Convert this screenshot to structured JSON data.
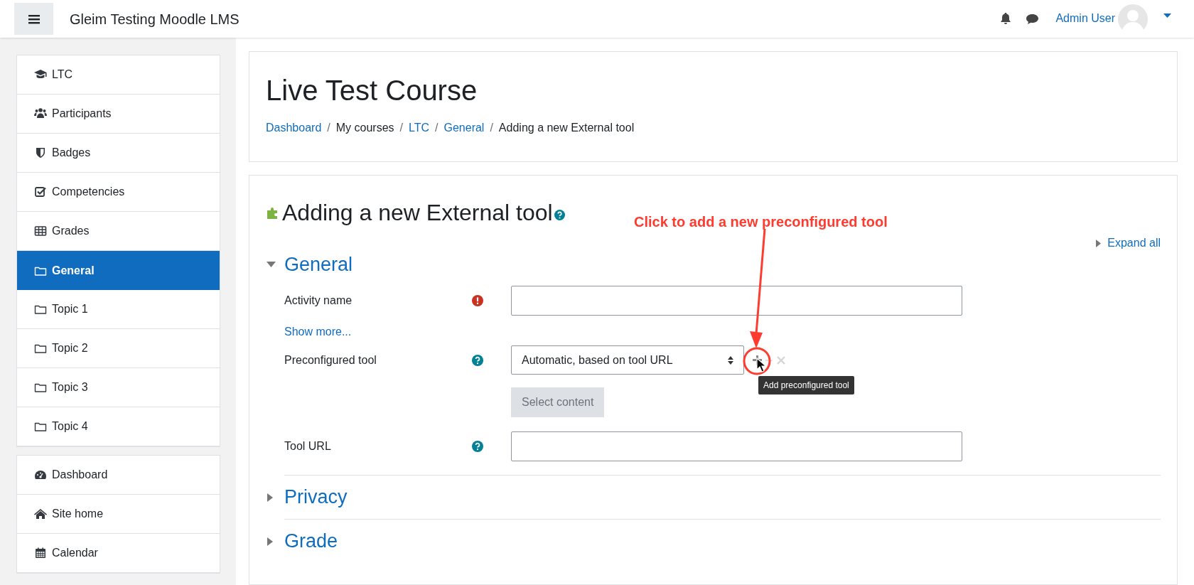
{
  "navbar": {
    "site_name": "Gleim Testing Moodle LMS",
    "user_name": "Admin User"
  },
  "sidebar": {
    "groups": [
      [
        {
          "label": "LTC",
          "selected": false
        },
        {
          "label": "Participants",
          "selected": false
        },
        {
          "label": "Badges",
          "selected": false
        },
        {
          "label": "Competencies",
          "selected": false
        },
        {
          "label": "Grades",
          "selected": false
        },
        {
          "label": "General",
          "selected": true
        },
        {
          "label": "Topic 1",
          "selected": false
        },
        {
          "label": "Topic 2",
          "selected": false
        },
        {
          "label": "Topic 3",
          "selected": false
        },
        {
          "label": "Topic 4",
          "selected": false
        }
      ],
      [
        {
          "label": "Dashboard",
          "selected": false
        },
        {
          "label": "Site home",
          "selected": false
        },
        {
          "label": "Calendar",
          "selected": false
        }
      ]
    ]
  },
  "course_header": {
    "title": "Live Test Course",
    "separator": "/",
    "breadcrumb": [
      {
        "label": "Dashboard",
        "link": true
      },
      {
        "label": "My courses",
        "link": false
      },
      {
        "label": "LTC",
        "link": true
      },
      {
        "label": "General",
        "link": true
      },
      {
        "label": "Adding a new External tool",
        "link": false
      }
    ]
  },
  "form": {
    "title": "Adding a new External tool",
    "expand_all": "Expand all",
    "sections": [
      {
        "title": "General",
        "expanded": true,
        "fields": [
          {
            "kind": "text",
            "label": "Activity name"
          },
          {
            "kind": "link",
            "label": "Show more..."
          },
          {
            "kind": "select",
            "label": "Preconfigured tool",
            "value": "Automatic, based on tool URL"
          },
          {
            "kind": "button",
            "label": "Select content"
          },
          {
            "kind": "text",
            "label": "Tool URL"
          }
        ]
      },
      {
        "title": "Privacy",
        "expanded": false
      },
      {
        "title": "Grade",
        "expanded": false
      }
    ]
  },
  "tooltip": "Add preconfigured tool",
  "annotation": "Click to add a new preconfigured tool"
}
